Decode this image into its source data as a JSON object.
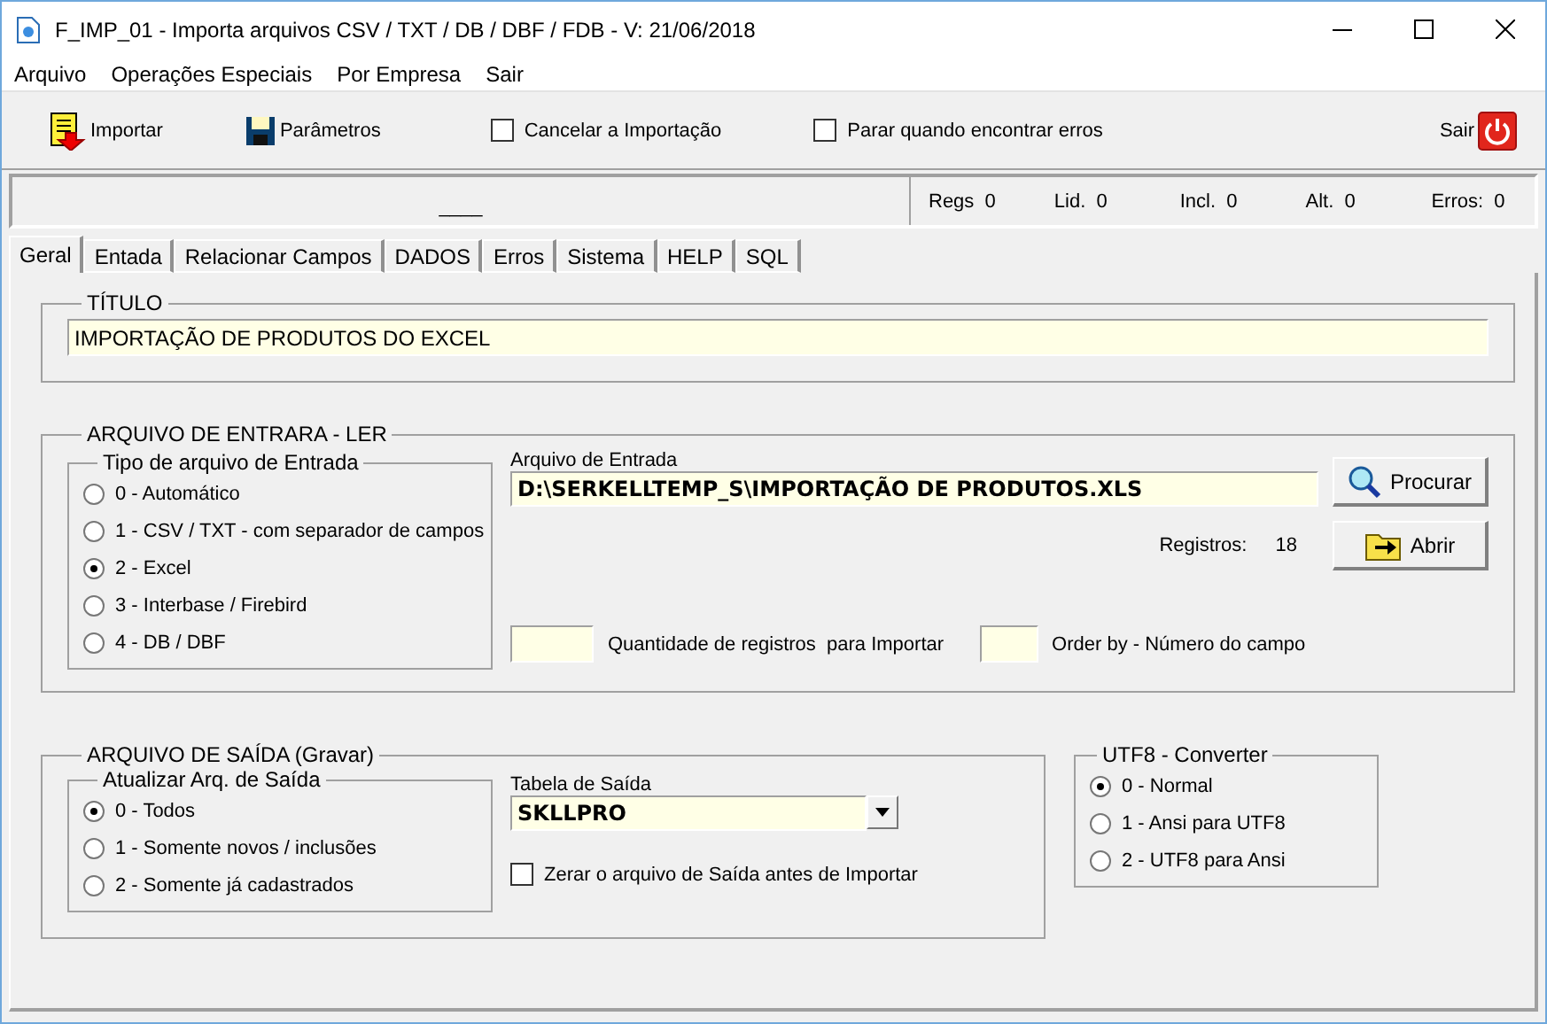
{
  "window": {
    "title": "F_IMP_01 - Importa arquivos CSV / TXT / DB / DBF / FDB - V: 21/06/2018"
  },
  "menu": [
    {
      "label": "Arquivo"
    },
    {
      "label": "Operações Especiais"
    },
    {
      "label": "Por Empresa"
    },
    {
      "label": "Sair"
    }
  ],
  "toolbar": {
    "import_button": "Importar",
    "params_button": "Parâmetros",
    "checkboxes": [
      {
        "label": "Cancelar a Importação",
        "checked": false
      },
      {
        "label": "Parar quando encontrar erros",
        "checked": false
      }
    ],
    "exit_button": "Sair"
  },
  "status": {
    "left_text": "____",
    "counters": [
      {
        "label": "Regs",
        "value": "0"
      },
      {
        "label": "Lid.",
        "value": "0"
      },
      {
        "label": "Incl.",
        "value": "0"
      },
      {
        "label": "Alt.",
        "value": "0"
      },
      {
        "label": "Erros:",
        "value": "0"
      }
    ]
  },
  "tabs": [
    {
      "label": "Geral",
      "selected": true
    },
    {
      "label": "Entada",
      "selected": false
    },
    {
      "label": "Relacionar Campos",
      "selected": false
    },
    {
      "label": "DADOS",
      "selected": false
    },
    {
      "label": "Erros",
      "selected": false
    },
    {
      "label": "Sistema",
      "selected": false
    },
    {
      "label": "HELP",
      "selected": false
    },
    {
      "label": "SQL",
      "selected": false
    }
  ],
  "title_group": {
    "legend": "TÍTULO",
    "value": "IMPORTAÇÃO DE PRODUTOS DO EXCEL"
  },
  "input_group": {
    "legend": "ARQUIVO DE ENTRARA - LER",
    "type_group": {
      "legend": "Tipo de arquivo de Entrada",
      "options": [
        {
          "label": "0 - Automático",
          "selected": false
        },
        {
          "label": "1 - CSV / TXT - com separador de campos",
          "selected": false
        },
        {
          "label": "2 - Excel",
          "selected": true
        },
        {
          "label": "3 - Interbase / Firebird",
          "selected": false
        },
        {
          "label": "4 - DB / DBF",
          "selected": false
        }
      ]
    },
    "file": {
      "label": "Arquivo de Entrada",
      "value": "D:\\SERKELLTEMP_S\\IMPORTAÇÃO DE PRODUTOS.XLS"
    },
    "browse_button": "Procurar",
    "records": {
      "label": "Registros:",
      "value": "18"
    },
    "open_button": "Abrir",
    "quantity": {
      "label": "Quantidade de registros  para Importar"
    },
    "order_by": {
      "label": "Order by - Número do campo"
    }
  },
  "output_group": {
    "legend": "ARQUIVO DE SAÍDA  (Gravar)",
    "update_group": {
      "legend": "Atualizar  Arq. de Saída",
      "options": [
        {
          "label": "0 - Todos",
          "selected": true
        },
        {
          "label": "1 - Somente novos / inclusões",
          "selected": false
        },
        {
          "label": "2 - Somente já cadastrados",
          "selected": false
        }
      ]
    },
    "table": {
      "label": "Tabela de Saída",
      "value": "SKLLPRO"
    },
    "clear_checkbox": {
      "label": "Zerar o arquivo de Saída antes de Importar",
      "checked": false
    }
  },
  "utf8_group": {
    "legend": "UTF8 - Converter",
    "options": [
      {
        "label": "0 - Normal",
        "selected": true
      },
      {
        "label": "1 - Ansi para UTF8",
        "selected": false
      },
      {
        "label": "2 - UTF8 para Ansi",
        "selected": false
      }
    ]
  }
}
